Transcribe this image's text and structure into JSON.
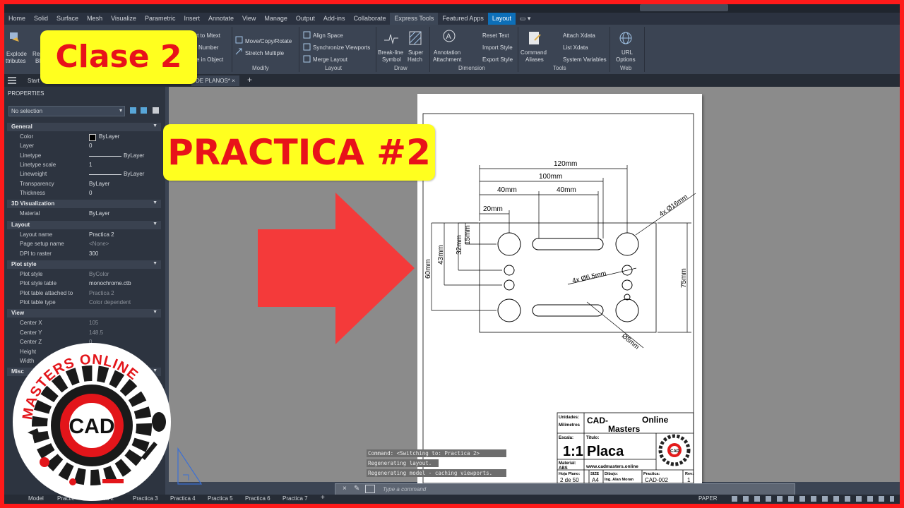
{
  "menu": {
    "tabs": [
      "Home",
      "Solid",
      "Surface",
      "Mesh",
      "Visualize",
      "Parametric",
      "Insert",
      "Annotate",
      "View",
      "Manage",
      "Output",
      "Add-ins",
      "Collaborate",
      "Express Tools",
      "Featured Apps",
      "Layout"
    ],
    "selected_index": 13,
    "active_index": 15
  },
  "ribbon": {
    "explode": "Explode",
    "attributes": "ttributes",
    "rep": "Rep",
    "bl": "Bl",
    "convert": "vert to Mtext",
    "number": "Number",
    "inobj": "se in Object",
    "move": "Move/Copy/Rotate",
    "stretch": "Stretch Multiple",
    "modify": "Modify",
    "align": "Align Space",
    "sync": "Synchronize Viewports",
    "merge": "Merge Layout",
    "layout_panel": "Layout",
    "breakline1": "Break-line",
    "breakline2": "Symbol",
    "super1": "Super",
    "super2": "Hatch",
    "draw": "Draw",
    "annot1": "Annotation",
    "annot2": "Attachment",
    "reset": "Reset Text",
    "import": "Import Style",
    "export": "Export Style",
    "dimension": "Dimension",
    "cmd1": "Command",
    "cmd2": "Aliases",
    "attach": "Attach Xdata",
    "list": "List Xdata",
    "sysvar": "System Variables",
    "tools": "Tools",
    "url1": "URL",
    "url2": "Options",
    "web": "Web"
  },
  "docbar": {
    "start": "Start",
    "file": "DE PLANOS*"
  },
  "properties": {
    "title": "PROPERTIES",
    "selection": "No selection",
    "general": "General",
    "color_k": "Color",
    "color_v": "ByLayer",
    "layer_k": "Layer",
    "layer_v": "0",
    "linetype_k": "Linetype",
    "linetype_v": "ByLayer",
    "ltscale_k": "Linetype scale",
    "ltscale_v": "1",
    "lweight_k": "Lineweight",
    "lweight_v": "ByLayer",
    "transp_k": "Transparency",
    "transp_v": "ByLayer",
    "thick_k": "Thickness",
    "thick_v": "0",
    "viz": "3D Visualization",
    "material_k": "Material",
    "material_v": "ByLayer",
    "layout": "Layout",
    "lname_k": "Layout name",
    "lname_v": "Practica 2",
    "psetup_k": "Page setup name",
    "psetup_v": "<None>",
    "dpi_k": "DPI to raster",
    "dpi_v": "300",
    "plotstyle": "Plot style",
    "pstyle_k": "Plot style",
    "pstyle_v": "ByColor",
    "ptable_k": "Plot style table",
    "ptable_v": "monochrome.ctb",
    "pattached_k": "Plot table attached to",
    "pattached_v": "Practica 2",
    "ptype_k": "Plot table type",
    "ptype_v": "Color dependent",
    "view": "View",
    "cx_k": "Center X",
    "cx_v": "105",
    "cy_k": "Center Y",
    "cy_v": "148.5",
    "cz_k": "Center Z",
    "cz_v": "0",
    "height_k": "Height",
    "width_k": "Width",
    "misc": "Misc"
  },
  "drawing": {
    "d120": "120mm",
    "d100": "100mm",
    "d40a": "40mm",
    "d40b": "40mm",
    "d20": "20mm",
    "d15": "15mm",
    "d32": "32mm",
    "d43": "43mm",
    "d60": "60mm",
    "d75": "75mm",
    "holes16": "4x Ø16mm",
    "holes65": "4x Ø6.5mm",
    "hole8": "Ø8mm"
  },
  "titleblock": {
    "unidades": "Unidades:",
    "milimetros": "Milimetros",
    "cad": "CAD-",
    "online": "Online",
    "masters": "Masters",
    "escala": "Escala:",
    "scale": "1:1",
    "titulo": "Titulo:",
    "placa": "Placa",
    "material": "Material:",
    "abs": "ABS",
    "web": "www.cadmasters.online",
    "hoja": "Hoja Plano:",
    "hoja_v": "2 de 50",
    "size": "SIZE",
    "size_v": "A4",
    "dibujo": "Dibujo:",
    "dibujo_v": "Ing. Alan Moran",
    "practica": "Practica:",
    "practica_v": "CAD-002",
    "rev": "Rev:",
    "rev_v": "1"
  },
  "commands": {
    "line1": "Command:   <Switching to: Practica 2>",
    "line2": "Regenerating layout.",
    "line3": "Regenerating model - caching viewports.",
    "placeholder": "Type a command"
  },
  "status": {
    "model": "Model",
    "tabs": [
      "Practic",
      "ca 2",
      "Practica 3",
      "Practica 4",
      "Practica 5",
      "Practica 6",
      "Practica 7"
    ],
    "paper": "PAPER"
  },
  "overlay": {
    "clase": "Clase 2",
    "practica": "PRACTICA #2",
    "logo_top": "MASTERS ONLINE",
    "logo_center": "CAD"
  },
  "colors": {
    "frame": "#ff1a1a",
    "banner_bg": "#ffff1f",
    "banner_text": "#e8121a",
    "arrow": "#f43a3a",
    "accent_tab": "#0d6fb8"
  }
}
